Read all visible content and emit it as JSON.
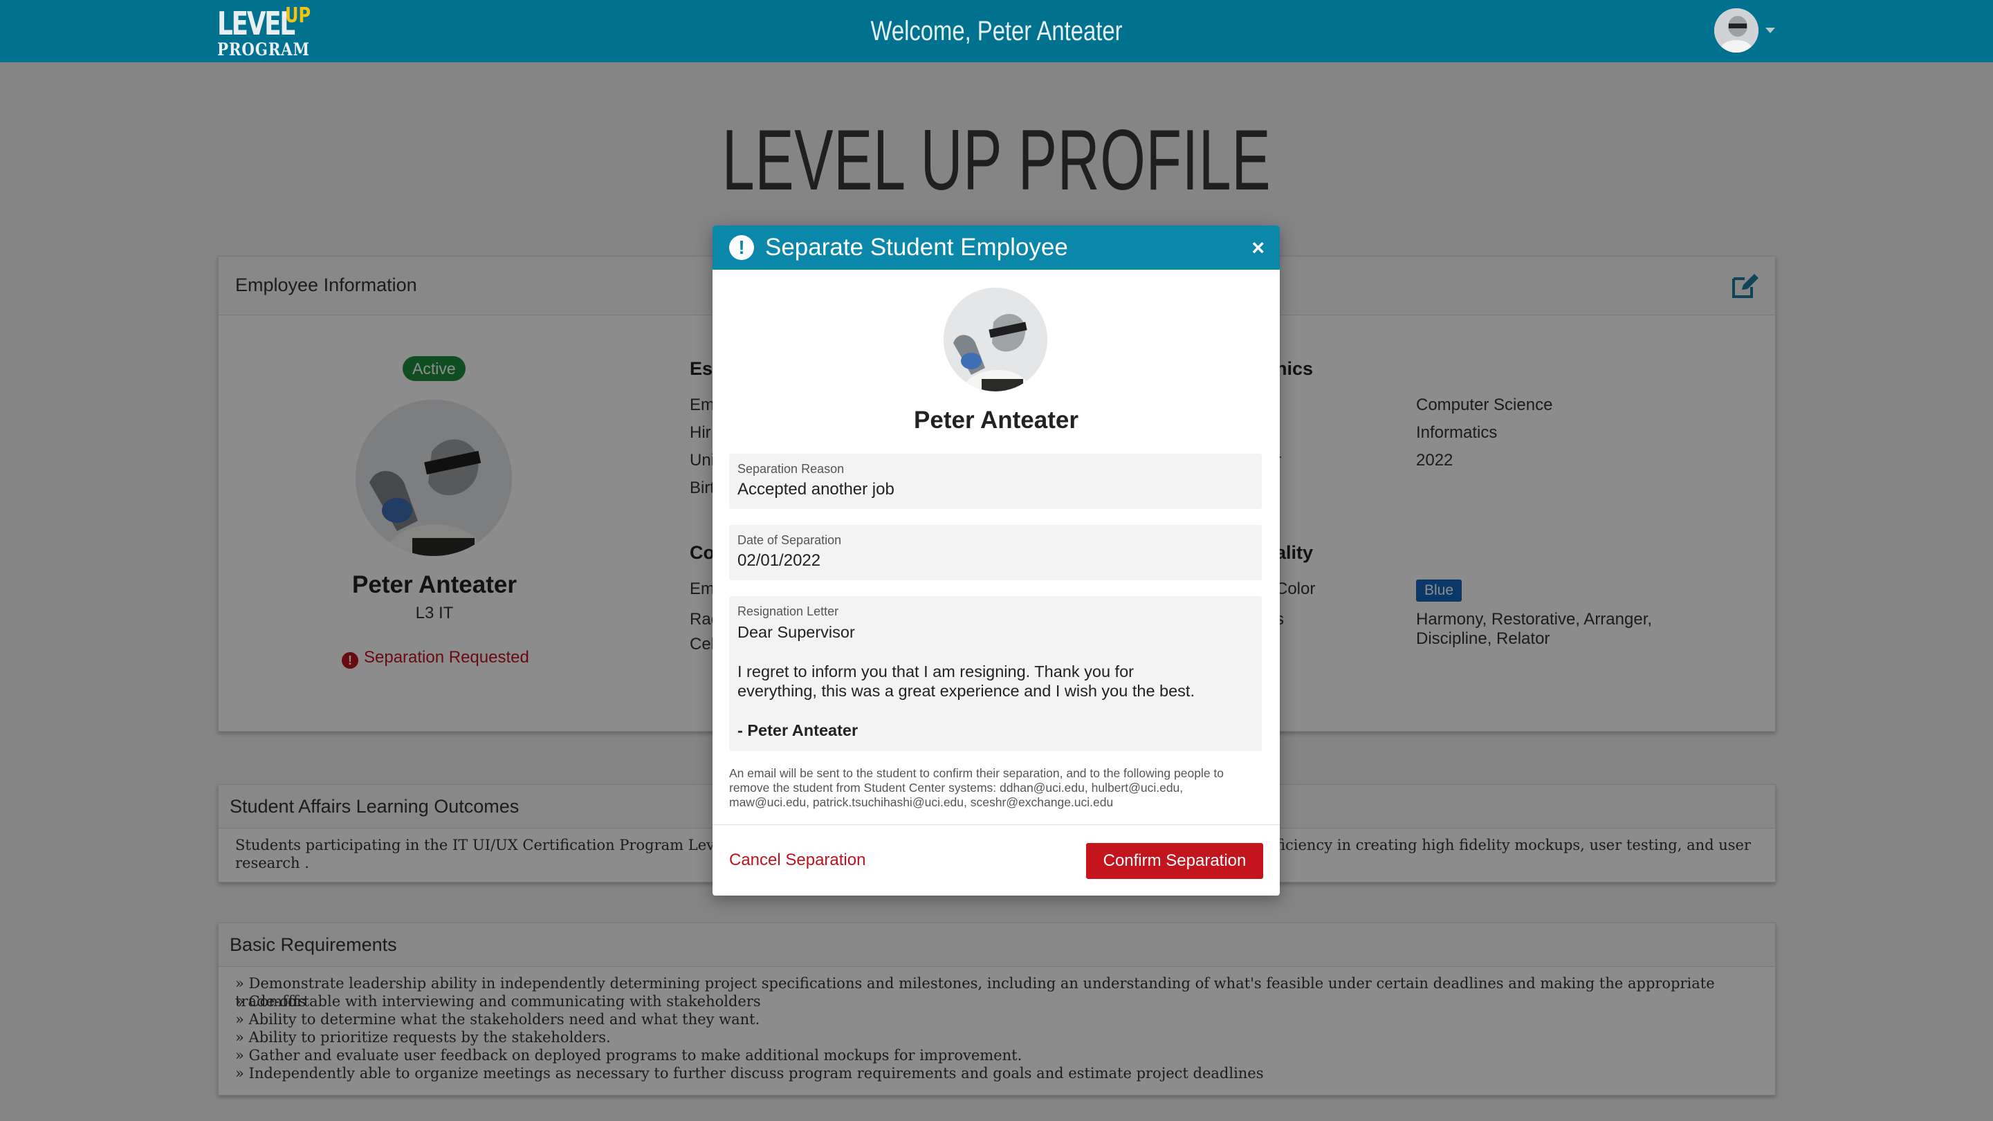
{
  "header": {
    "logo_level": "LEVEL",
    "logo_up": "UP",
    "logo_program": "PROGRAM",
    "welcome": "Welcome, Peter Anteater"
  },
  "page": {
    "title": "LEVEL UP PROFILE"
  },
  "employee_card": {
    "title": "Employee Information",
    "status_badge": "Active",
    "name": "Peter Anteater",
    "role": "L3 IT",
    "separation_status": "Separation Requested",
    "essentials_heading_fragment": "Ess",
    "essentials_label_fragments": [
      "Em",
      "Hir",
      "Uni",
      "Birt"
    ],
    "contact_heading_fragment": "Co",
    "contact_label_fragments": [
      "Em",
      "Rac",
      "Cel"
    ],
    "academics_heading_fragment": "nics",
    "academics_label_fragment": "r",
    "academics_values": [
      "Computer Science",
      "Informatics",
      "2022"
    ],
    "personality_heading_fragment": "ality",
    "personality_label_fragments": [
      "Color",
      "s"
    ],
    "color_badge": "Blue",
    "strengths": "Harmony, Restorative, Arranger, Discipline, Relator"
  },
  "learning_outcomes": {
    "title": "Student Affairs Learning Outcomes",
    "text_left": "Students participating in the IT UI/UX Certification Program Level 4 w",
    "text_right": "ficiency in creating high fidelity mockups, user testing, and user",
    "text_line2": "research ."
  },
  "basic_requirements": {
    "title": "Basic Requirements",
    "items": [
      "» Demonstrate leadership ability in independently determining project specifications and milestones, including an understanding of what's feasible under certain deadlines and making the appropriate trade-offs",
      "» Comfortable with interviewing and communicating with stakeholders",
      "» Ability to determine what the stakeholders need and what they want.",
      "» Ability to prioritize requests by the stakeholders.",
      "» Gather and evaluate user feedback on deployed programs to make additional mockups for improvement.",
      "» Independently able to organize meetings as necessary to further discuss program requirements and goals and estimate project deadlines"
    ]
  },
  "modal": {
    "title": "Separate Student Employee",
    "close_label": "×",
    "name": "Peter Anteater",
    "reason_label": "Separation Reason",
    "reason_value": "Accepted another job",
    "date_label": "Date of Separation",
    "date_value": "02/01/2022",
    "letter_label": "Resignation Letter",
    "letter_greeting": "Dear Supervisor",
    "letter_body_1": "I regret to inform you that I am resigning. Thank you for",
    "letter_body_2": "everything, this was a great experience and I wish you the best.",
    "letter_signature": "- Peter Anteater",
    "note_1": "An email will be sent to the student to confirm their separation, and to the following people to",
    "note_2": "remove the student from Student Center systems: ddhan@uci.edu, hulbert@uci.edu,",
    "note_3": "maw@uci.edu, patrick.tsuchihashi@uci.edu, sceshr@exchange.uci.edu",
    "cancel_label": "Cancel Separation",
    "confirm_label": "Confirm Separation"
  },
  "colors": {
    "header": "#00718e",
    "modal_header": "#0b87a9",
    "danger": "#c4141d",
    "active": "#1e8e3e",
    "badge_blue": "#1565c0"
  },
  "icons": [
    "avatar",
    "chevron-down-icon",
    "edit-icon",
    "exclamation-circle-icon",
    "close-icon"
  ]
}
